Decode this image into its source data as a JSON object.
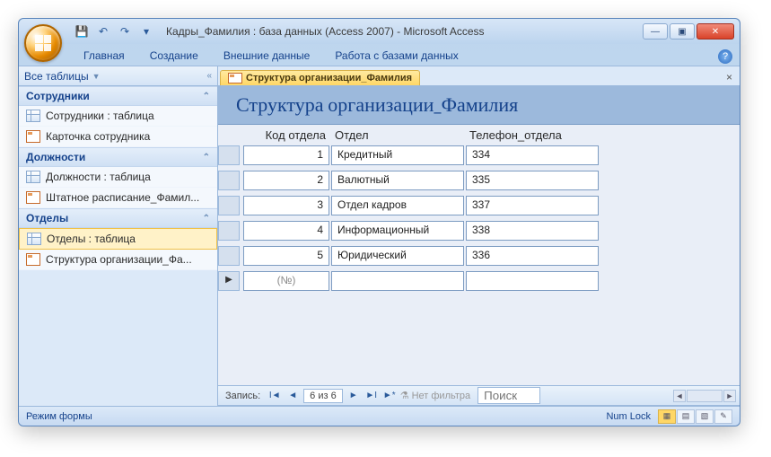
{
  "window": {
    "title": "Кадры_Фамилия : база данных (Access 2007)  -  Microsoft Access"
  },
  "ribbon": {
    "tabs": [
      "Главная",
      "Создание",
      "Внешние данные",
      "Работа с базами данных"
    ]
  },
  "nav": {
    "header": "Все таблицы",
    "groups": [
      {
        "title": "Сотрудники",
        "items": [
          {
            "label": "Сотрудники : таблица",
            "icon": "table"
          },
          {
            "label": "Карточка сотрудника",
            "icon": "form"
          }
        ]
      },
      {
        "title": "Должности",
        "items": [
          {
            "label": "Должности : таблица",
            "icon": "table"
          },
          {
            "label": "Штатное расписание_Фамил...",
            "icon": "form"
          }
        ]
      },
      {
        "title": "Отделы",
        "items": [
          {
            "label": "Отделы : таблица",
            "icon": "table",
            "selected": true
          },
          {
            "label": "Структура организации_Фа...",
            "icon": "form"
          }
        ]
      }
    ]
  },
  "doc": {
    "tab_label": "Структура организации_Фамилия",
    "form_title": "Структура организации_Фамилия",
    "columns": [
      "Код отдела",
      "Отдел",
      "Телефон_отдела"
    ],
    "rows": [
      {
        "id": "1",
        "dept": "Кредитный",
        "phone": "334"
      },
      {
        "id": "2",
        "dept": "Валютный",
        "phone": "335"
      },
      {
        "id": "3",
        "dept": "Отдел кадров",
        "phone": "337"
      },
      {
        "id": "4",
        "dept": "Информационный",
        "phone": "338"
      },
      {
        "id": "5",
        "dept": "Юридический",
        "phone": "336"
      }
    ],
    "new_row_placeholder": "(№)"
  },
  "recnav": {
    "label": "Запись:",
    "position": "6 из 6",
    "filter_label": "Нет фильтра",
    "search_placeholder": "Поиск"
  },
  "status": {
    "mode": "Режим формы",
    "numlock": "Num Lock"
  }
}
